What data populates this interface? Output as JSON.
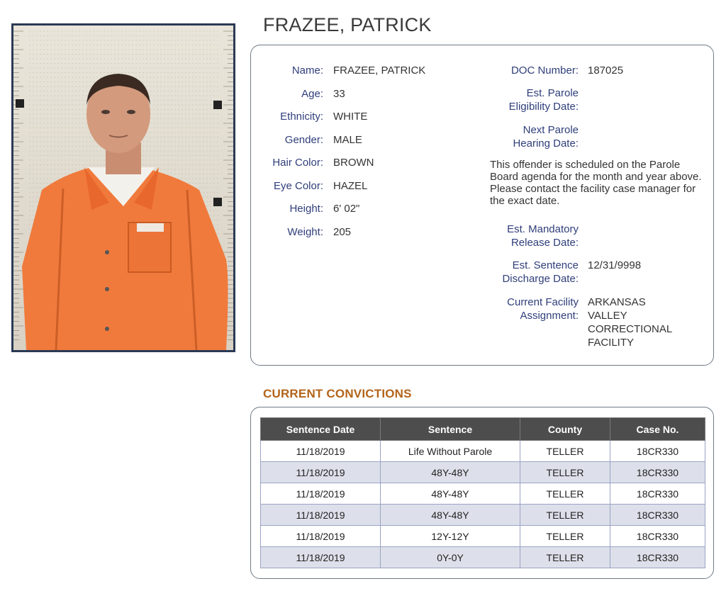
{
  "profile": {
    "title": "FRAZEE, PATRICK",
    "fields_left": [
      {
        "label": "Name:",
        "value": "FRAZEE, PATRICK"
      },
      {
        "label": "Age:",
        "value": "33"
      },
      {
        "label": "Ethnicity:",
        "value": "WHITE"
      },
      {
        "label": "Gender:",
        "value": "MALE"
      },
      {
        "label": "Hair Color:",
        "value": "BROWN"
      },
      {
        "label": "Eye Color:",
        "value": "HAZEL"
      },
      {
        "label": "Height:",
        "value": "6' 02\""
      },
      {
        "label": "Weight:",
        "value": "205"
      }
    ],
    "doc_number_label": "DOC Number:",
    "doc_number_value": "187025",
    "parole_elig_label_1": "Est. Parole",
    "parole_elig_label_2": "Eligibility Date:",
    "parole_elig_value": "",
    "next_hearing_label_1": "Next Parole",
    "next_hearing_label_2": "Hearing Date:",
    "next_hearing_value": "",
    "note": "This offender is scheduled on the Parole Board agenda for the month and year above. Please contact the facility case manager for the exact date.",
    "mandatory_release_label_1": "Est. Mandatory",
    "mandatory_release_label_2": "Release Date:",
    "mandatory_release_value": "",
    "sentence_discharge_label_1": "Est. Sentence",
    "sentence_discharge_label_2": "Discharge Date:",
    "sentence_discharge_value": "12/31/9998",
    "facility_label_1": "Current Facility",
    "facility_label_2": "Assignment:",
    "facility_value_lines": [
      "ARKANSAS",
      "VALLEY",
      "CORRECTIONAL",
      "FACILITY"
    ]
  },
  "convictions": {
    "title": "CURRENT CONVICTIONS",
    "headers": [
      "Sentence Date",
      "Sentence",
      "County",
      "Case No."
    ],
    "rows": [
      [
        "11/18/2019",
        "Life Without Parole",
        "TELLER",
        "18CR330"
      ],
      [
        "11/18/2019",
        "48Y-48Y",
        "TELLER",
        "18CR330"
      ],
      [
        "11/18/2019",
        "48Y-48Y",
        "TELLER",
        "18CR330"
      ],
      [
        "11/18/2019",
        "48Y-48Y",
        "TELLER",
        "18CR330"
      ],
      [
        "11/18/2019",
        "12Y-12Y",
        "TELLER",
        "18CR330"
      ],
      [
        "11/18/2019",
        "0Y-0Y",
        "TELLER",
        "18CR330"
      ]
    ]
  },
  "colors": {
    "label": "#2f3e7a",
    "section_title": "#b3641b",
    "table_header": "#4d4d4d",
    "row_alt": "#dde0ea",
    "jumpsuit": "#f07a3c"
  }
}
